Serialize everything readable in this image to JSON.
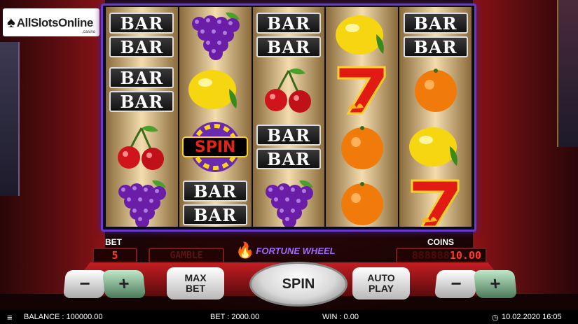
{
  "logo": {
    "brand": "AllSlotsOnline",
    "suffix": ".casino"
  },
  "reels": [
    [
      "BAR|BAR",
      "BAR|BAR",
      "cherries",
      "grapes"
    ],
    [
      "grapes",
      "lemon",
      "spin-wheel",
      "BAR|BAR"
    ],
    [
      "BAR|BAR",
      "cherries",
      "BAR|BAR",
      "grapes"
    ],
    [
      "lemon",
      "seven",
      "orange",
      "orange"
    ],
    [
      "BAR|BAR",
      "orange",
      "lemon",
      "seven"
    ]
  ],
  "spin_symbol_text": "SPIN",
  "bar_text": "BAR",
  "bet": {
    "label": "BET",
    "value": "5"
  },
  "gamble": {
    "label": "GAMBLE"
  },
  "game_title": "FORTUNE WHEEL",
  "coins": {
    "label": "COINS",
    "ghost": "888888",
    "value": "10.00"
  },
  "buttons": {
    "minus": "−",
    "plus": "+",
    "max_bet": "MAX\nBET",
    "spin": "SPIN",
    "auto_play": "AUTO\nPLAY"
  },
  "status": {
    "menu_icon": "hamburger-icon",
    "balance": "BALANCE : 100000.00",
    "bet": "BET : 2000.00",
    "win": "WIN : 0.00",
    "clock_icon": "clock-icon",
    "datetime": "10.02.2020 16:05"
  }
}
